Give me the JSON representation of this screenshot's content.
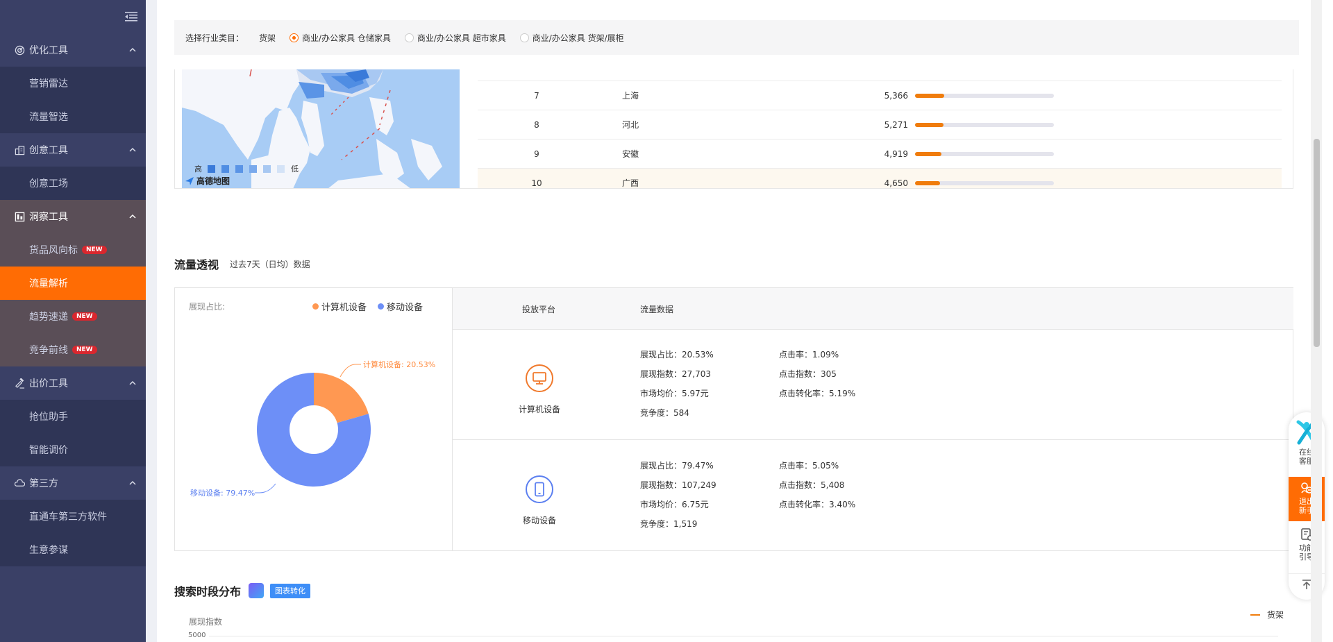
{
  "sidebar": {
    "groups": [
      {
        "label": "优化工具",
        "items": [
          "营销雷达",
          "流量智选"
        ]
      },
      {
        "label": "创意工具",
        "items": [
          "创意工场"
        ]
      },
      {
        "label": "洞察工具",
        "items": [
          "货品风向标",
          "流量解析",
          "趋势速递",
          "竞争前线"
        ]
      },
      {
        "label": "出价工具",
        "items": [
          "抢位助手",
          "智能调价"
        ]
      },
      {
        "label": "第三方",
        "items": [
          "直通车第三方软件",
          "生意参谋"
        ]
      }
    ],
    "badge_new": "NEW",
    "active_item": "流量解析"
  },
  "category_bar": {
    "label": "选择行业类目：",
    "category": "货架",
    "options": [
      "商业/办公家具 仓储家具",
      "商业/办公家具 超市家具",
      "商业/办公家具 货架/展柜"
    ],
    "selected_index": 0
  },
  "map": {
    "legend_high": "高",
    "legend_low": "低",
    "provider": "高德地图"
  },
  "ranking": {
    "rows": [
      {
        "rank": "7",
        "province": "上海",
        "value": "5,366",
        "fraction": 0.21
      },
      {
        "rank": "8",
        "province": "河北",
        "value": "5,271",
        "fraction": 0.205
      },
      {
        "rank": "9",
        "province": "安徽",
        "value": "4,919",
        "fraction": 0.19
      },
      {
        "rank": "10",
        "province": "广西",
        "value": "4,650",
        "fraction": 0.18
      }
    ]
  },
  "traffic": {
    "title": "流量透视",
    "subtitle": "过去7天（日均）数据",
    "ratio_label": "展现占比:",
    "legend": [
      {
        "name": "计算机设备",
        "color": "#ff9852"
      },
      {
        "name": "移动设备",
        "color": "#6d8ff7"
      }
    ],
    "pie_labels": {
      "pc": "计算机设备: 20.53%",
      "mobile": "移动设备: 79.47%"
    },
    "header": {
      "platform": "投放平台",
      "data": "流量数据"
    },
    "platforms": [
      {
        "name": "计算机设备",
        "icon": "monitor-icon",
        "color": "#f0792c",
        "share_pct": 20.53,
        "stats": {
          "share": "展现占比：20.53%",
          "ctr": "点击率：1.09%",
          "impressions": "展现指数：27,703",
          "clicks": "点击指数：305",
          "price": "市场均价：5.97元",
          "cvr": "点击转化率：5.19%",
          "competition": "竞争度：584"
        }
      },
      {
        "name": "移动设备",
        "icon": "phone-icon",
        "color": "#5b7ff0",
        "share_pct": 79.47,
        "stats": {
          "share": "展现占比：79.47%",
          "ctr": "点击率：5.05%",
          "impressions": "展现指数：107,249",
          "clicks": "点击指数：5,408",
          "price": "市场均价：6.75元",
          "cvr": "点击转化率：3.40%",
          "competition": "竞争度：1,519"
        }
      }
    ]
  },
  "search_time": {
    "title": "搜索时段分布",
    "convert_button": "图表转化",
    "y_label": "展现指数",
    "y_tick_top": "5000",
    "series": "货架"
  },
  "float_panel": {
    "service": "在线客服",
    "exit_novice": "退出新手",
    "guide": "功能引导"
  }
}
